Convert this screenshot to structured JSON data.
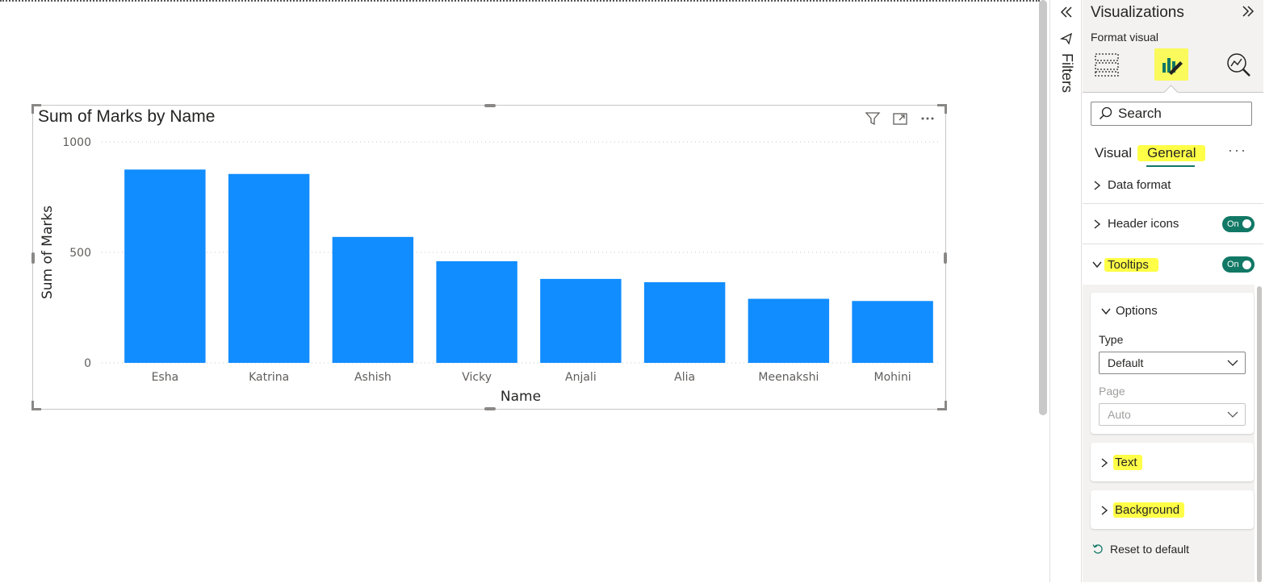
{
  "chart_data": {
    "type": "bar",
    "title": "Sum of Marks by Name",
    "xlabel": "Name",
    "ylabel": "Sum of Marks",
    "categories": [
      "Esha",
      "Katrina",
      "Ashish",
      "Vicky",
      "Anjali",
      "Alia",
      "Meenakshi",
      "Mohini"
    ],
    "values": [
      875,
      855,
      570,
      460,
      380,
      365,
      290,
      280
    ],
    "yticks": [
      0,
      500,
      1000
    ],
    "ytick_labels": [
      "0",
      "500",
      "1000"
    ],
    "ylim": [
      0,
      1000
    ],
    "grid": true,
    "color": "#118dff"
  },
  "filters_pane": {
    "label": "Filters",
    "collapse_icon": "double-chevron-left-icon",
    "filter_icon": "filter-pin-icon"
  },
  "visualizations_pane": {
    "title": "Visualizations",
    "expand_icon": "double-chevron-right-icon",
    "format_label": "Format visual",
    "tabs": [
      {
        "name": "build-visual-icon"
      },
      {
        "name": "format-visual-icon",
        "active": true
      },
      {
        "name": "analytics-icon"
      }
    ],
    "search_placeholder": "Search",
    "sub_tabs": {
      "visual": "Visual",
      "general": "General",
      "more": "···"
    },
    "sections": {
      "data_format": "Data format",
      "header_icons": "Header icons",
      "header_icons_toggle": "On",
      "tooltips": "Tooltips",
      "tooltips_toggle": "On"
    },
    "options_card": {
      "title": "Options",
      "type_label": "Type",
      "type_value": "Default",
      "page_label": "Page",
      "page_value": "Auto"
    },
    "text_card": "Text",
    "background_card": "Background",
    "reset_label": "Reset to default"
  },
  "colors": {
    "accent": "#117865",
    "highlight": "#ffff47",
    "bar": "#118dff"
  }
}
